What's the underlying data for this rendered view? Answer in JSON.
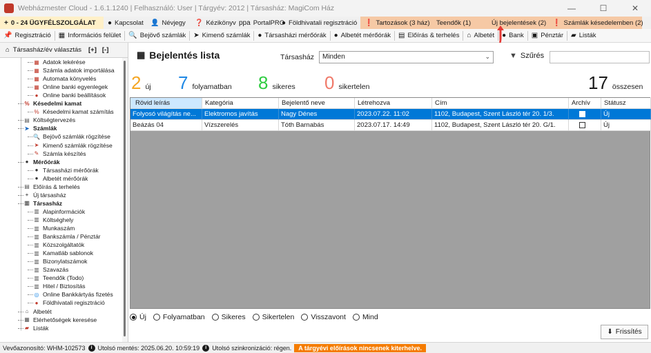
{
  "window": {
    "title": "Webházmester Cloud - 1.6.1.1240 | Felhasználó: User | Tárgyév: 2012 | Társasház: MagiCom Ház",
    "minimize_icon": "minimize-icon",
    "maximize_icon": "maximize-icon",
    "close_icon": "close-icon"
  },
  "toolbar1": {
    "items": [
      {
        "label": "0 - 24 ÜGYFÉLSZOLGÁLAT",
        "icon": "+",
        "bg": "#fff0c8"
      },
      {
        "label": "Kapcsolat",
        "icon": "●"
      },
      {
        "label": "Névjegy",
        "icon": "👤"
      },
      {
        "label": "Kézikönyv",
        "icon": "❓"
      },
      {
        "label": "PortalPRO",
        "icon": "ppa"
      },
      {
        "label": "Földhivatali regisztráció",
        "icon": "●"
      },
      {
        "label": "Tartozások (3 ház)",
        "icon": "❗",
        "bg": "#f6c9a5"
      },
      {
        "label": "Teendők (1)",
        "icon": "",
        "bg": "#f6c9a5"
      },
      {
        "label": "Új bejelentések (2)",
        "icon": "",
        "bg": "#f6c9a5"
      },
      {
        "label": "Számlák késedelemben (2)",
        "icon": "❗",
        "bg": "#f6c9a5"
      }
    ]
  },
  "toolbar2": {
    "items": [
      {
        "label": "Regisztráció",
        "icon": "📌"
      },
      {
        "label": "Információs felület",
        "icon": "▦"
      },
      {
        "label": "Bejövő számlák",
        "icon": "🔍"
      },
      {
        "label": "Kimenő számlák",
        "icon": "➤"
      },
      {
        "label": "Társasházi mérőórák",
        "icon": "●"
      },
      {
        "label": "Albetét mérőórák",
        "icon": "●"
      },
      {
        "label": "Előírás & terhelés",
        "icon": "▤"
      },
      {
        "label": "Albetét",
        "icon": "⌂"
      },
      {
        "label": "Bank",
        "icon": "●"
      },
      {
        "label": "Pénztár",
        "icon": "▣"
      },
      {
        "label": "Listák",
        "icon": "▰"
      }
    ]
  },
  "leftpanel": {
    "header_label": "Társasház/év választás",
    "expand_label": "[+]",
    "collapse_label": "[-]",
    "tree": [
      {
        "label": "Adatok lekérése",
        "lvl": 2,
        "icon": "▦",
        "c": "#c0392b"
      },
      {
        "label": "Számla adatok importálása",
        "lvl": 2,
        "icon": "▦",
        "c": "#c0392b"
      },
      {
        "label": "Automata könyvelés",
        "lvl": 2,
        "icon": "▦",
        "c": "#c0392b"
      },
      {
        "label": "Online banki egyenlegek",
        "lvl": 2,
        "icon": "▦",
        "c": "#c0392b"
      },
      {
        "label": "Online banki beállítások",
        "lvl": 2,
        "icon": "●",
        "c": "#c0392b"
      },
      {
        "label": "Késedelmi kamat",
        "lvl": 1,
        "icon": "%",
        "c": "#c0392b",
        "bold": true
      },
      {
        "label": "Késedelmi kamat számítás",
        "lvl": 2,
        "icon": "%",
        "c": "#c0392b"
      },
      {
        "label": "Költségtervezés",
        "lvl": 1,
        "icon": "▤",
        "c": "#555"
      },
      {
        "label": "Számlák",
        "lvl": 1,
        "icon": "➤",
        "c": "#1565c0",
        "bold": true
      },
      {
        "label": "Bejövő számlák rögzítése",
        "lvl": 2,
        "icon": "🔍",
        "c": "#555"
      },
      {
        "label": "Kimenő számlák rögzítése",
        "lvl": 2,
        "icon": "➤",
        "c": "#c0392b"
      },
      {
        "label": "Számla készítés",
        "lvl": 2,
        "icon": "✎",
        "c": "#c0392b"
      },
      {
        "label": "Mérőórák",
        "lvl": 1,
        "icon": "●",
        "c": "#333",
        "bold": true
      },
      {
        "label": "Társasházi mérőórák",
        "lvl": 2,
        "icon": "●",
        "c": "#333"
      },
      {
        "label": "Albetét mérőórák",
        "lvl": 2,
        "icon": "●",
        "c": "#333"
      },
      {
        "label": "Előírás & terhelés",
        "lvl": 1,
        "icon": "▤",
        "c": "#555"
      },
      {
        "label": "Új társasház",
        "lvl": 1,
        "icon": "+",
        "c": "#1a1a1a"
      },
      {
        "label": "Társasház",
        "lvl": 1,
        "icon": "▥",
        "c": "#555",
        "bold": true
      },
      {
        "label": "Alapinformációk",
        "lvl": 2,
        "icon": "▥",
        "c": "#555"
      },
      {
        "label": "Költséghely",
        "lvl": 2,
        "icon": "▥",
        "c": "#555"
      },
      {
        "label": "Munkaszám",
        "lvl": 2,
        "icon": "▥",
        "c": "#555"
      },
      {
        "label": "Bankszámla / Pénztár",
        "lvl": 2,
        "icon": "▥",
        "c": "#555"
      },
      {
        "label": "Közszolgáltatók",
        "lvl": 2,
        "icon": "▥",
        "c": "#555"
      },
      {
        "label": "Kamatláb sablonok",
        "lvl": 2,
        "icon": "▥",
        "c": "#555"
      },
      {
        "label": "Bizonylatszámok",
        "lvl": 2,
        "icon": "▥",
        "c": "#555"
      },
      {
        "label": "Szavazás",
        "lvl": 2,
        "icon": "▥",
        "c": "#555"
      },
      {
        "label": "Teendők (Todo)",
        "lvl": 2,
        "icon": "▥",
        "c": "#555"
      },
      {
        "label": "Hitel / Biztosítás",
        "lvl": 2,
        "icon": "▥",
        "c": "#555"
      },
      {
        "label": "Online Bankkártyás fizetés",
        "lvl": 2,
        "icon": "◎",
        "c": "#1e88e5"
      },
      {
        "label": "Földhivatali regisztráció",
        "lvl": 2,
        "icon": "●",
        "c": "#c0392b"
      },
      {
        "label": "Albetét",
        "lvl": 1,
        "icon": "⌂",
        "c": "#555"
      },
      {
        "label": "Elérhetőségek keresése",
        "lvl": 1,
        "icon": "▦",
        "c": "#555"
      },
      {
        "label": "Listák",
        "lvl": 1,
        "icon": "▰",
        "c": "#c0392b"
      }
    ]
  },
  "main": {
    "title": "Bejelentés lista",
    "tarsashaz_label": "Társasház",
    "tarsashaz_value": "Minden",
    "filter_label": "Szűrés",
    "filter_value": "",
    "stats": [
      {
        "num": "2",
        "txt": "új",
        "color": "#f5a623"
      },
      {
        "num": "7",
        "txt": "folyamatban",
        "color": "#1e88e5"
      },
      {
        "num": "8",
        "txt": "sikeres",
        "color": "#2ecc40"
      },
      {
        "num": "0",
        "txt": "sikertelen",
        "color": "#f07a6a"
      },
      {
        "num": "17",
        "txt": "összesen",
        "color": "#1a1a1a"
      }
    ],
    "columns": [
      "Rövid leírás",
      "Kategória",
      "Bejelentő neve",
      "Létrehozva",
      "Cím",
      "Archív",
      "Státusz"
    ],
    "rows": [
      {
        "rovid": "Folyosó világítás ne...",
        "kategoria": "Elektromos javítás",
        "bejelento": "Nagy Dénes",
        "letrehozva": "2023.07.22. 11:02",
        "cim": "1102, Budapest, Szent László tér 20.  1/3.",
        "archiv": false,
        "statusz": "Új"
      },
      {
        "rovid": "Beázás 04",
        "kategoria": "Vízszerelés",
        "bejelento": "Tóth Barnabás",
        "letrehozva": "2023.07.17. 14:49",
        "cim": "1102, Budapest, Szent László tér 20.  G/1.",
        "archiv": false,
        "statusz": "Új"
      }
    ],
    "radios": [
      {
        "label": "Új",
        "checked": true
      },
      {
        "label": "Folyamatban",
        "checked": false
      },
      {
        "label": "Sikeres",
        "checked": false
      },
      {
        "label": "Sikertelen",
        "checked": false
      },
      {
        "label": "Visszavont",
        "checked": false
      },
      {
        "label": "Mind",
        "checked": false
      }
    ],
    "refresh_label": "Frissítés"
  },
  "statusbar": {
    "vevoazonosito": "Vevőazonosító: WHM-102573",
    "mentes": "Utolsó mentés: 2025.06.20. 10:59:19",
    "szinkron": "Utolsó szinkronizáció: régen.",
    "warning": "A tárgyévi előírások nincsenek kiterhelve."
  }
}
